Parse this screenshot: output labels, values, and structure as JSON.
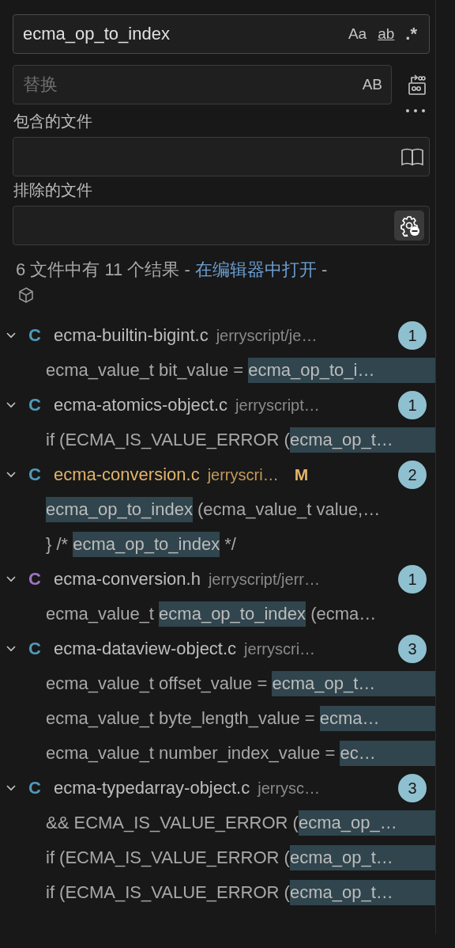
{
  "search": {
    "value": "ecma_op_to_index",
    "toggles": [
      {
        "label": "Aa",
        "kind": "case",
        "on": false
      },
      {
        "label": "ab",
        "kind": "word",
        "on": false
      },
      {
        "label": ".*",
        "kind": "regex",
        "on": false
      }
    ]
  },
  "replace": {
    "placeholder": "替换",
    "toggle": {
      "label": "AB",
      "on": false
    }
  },
  "include": {
    "label": "包含的文件"
  },
  "exclude": {
    "label": "排除的文件",
    "settings_active": true
  },
  "summary": {
    "text": "6 文件中有 11 个结果 - ",
    "link": "在编辑器中打开",
    "tail": " -"
  },
  "results": [
    {
      "expanded": true,
      "icon": "C",
      "color": "#519aba",
      "name": "ecma-builtin-bigint.c",
      "path": "jerryscript/je…",
      "modified": false,
      "count": "1",
      "matches": [
        [
          {
            "text": "ecma_value_t bit_value = ",
            "match": false
          },
          {
            "text": "ecma_op_to_i…",
            "match": true
          }
        ]
      ]
    },
    {
      "expanded": true,
      "icon": "C",
      "color": "#519aba",
      "name": "ecma-atomics-object.c",
      "path": "jerryscript…",
      "modified": false,
      "count": "1",
      "matches": [
        [
          {
            "text": "if (ECMA_IS_VALUE_ERROR (",
            "match": false
          },
          {
            "text": "ecma_op_t…",
            "match": true
          }
        ]
      ]
    },
    {
      "expanded": true,
      "icon": "C",
      "color": "#519aba",
      "name": "ecma-conversion.c",
      "path": "jerryscri…",
      "modified": true,
      "badge": "M",
      "count": "2",
      "matches": [
        [
          {
            "text": "ecma_op_to_index",
            "match": true
          },
          {
            "text": " (ecma_value_t value,…",
            "match": false
          }
        ],
        [
          {
            "text": "} /* ",
            "match": false
          },
          {
            "text": "ecma_op_to_index",
            "match": true
          },
          {
            "text": " */",
            "match": false
          }
        ]
      ]
    },
    {
      "expanded": true,
      "icon": "C",
      "color": "#a074c4",
      "name": "ecma-conversion.h",
      "path": "jerryscript/jerr…",
      "modified": false,
      "count": "1",
      "matches": [
        [
          {
            "text": "ecma_value_t ",
            "match": false
          },
          {
            "text": "ecma_op_to_index",
            "match": true
          },
          {
            "text": " (ecma…",
            "match": false
          }
        ]
      ]
    },
    {
      "expanded": true,
      "icon": "C",
      "color": "#519aba",
      "name": "ecma-dataview-object.c",
      "path": "jerryscri…",
      "modified": false,
      "count": "3",
      "matches": [
        [
          {
            "text": "ecma_value_t offset_value = ",
            "match": false
          },
          {
            "text": "ecma_op_t…",
            "match": true
          }
        ],
        [
          {
            "text": "ecma_value_t byte_length_value = ",
            "match": false
          },
          {
            "text": "ecma…",
            "match": true
          }
        ],
        [
          {
            "text": "ecma_value_t number_index_value = ",
            "match": false
          },
          {
            "text": "ec…",
            "match": true
          }
        ]
      ]
    },
    {
      "expanded": true,
      "icon": "C",
      "color": "#519aba",
      "name": "ecma-typedarray-object.c",
      "path": "jerrysc…",
      "modified": false,
      "count": "3",
      "matches": [
        [
          {
            "text": "&& ECMA_IS_VALUE_ERROR (",
            "match": false
          },
          {
            "text": "ecma_op_…",
            "match": true
          }
        ],
        [
          {
            "text": "if (ECMA_IS_VALUE_ERROR (",
            "match": false
          },
          {
            "text": "ecma_op_t…",
            "match": true
          }
        ],
        [
          {
            "text": "if (ECMA_IS_VALUE_ERROR (",
            "match": false
          },
          {
            "text": "ecma_op_t…",
            "match": true
          }
        ]
      ]
    }
  ]
}
